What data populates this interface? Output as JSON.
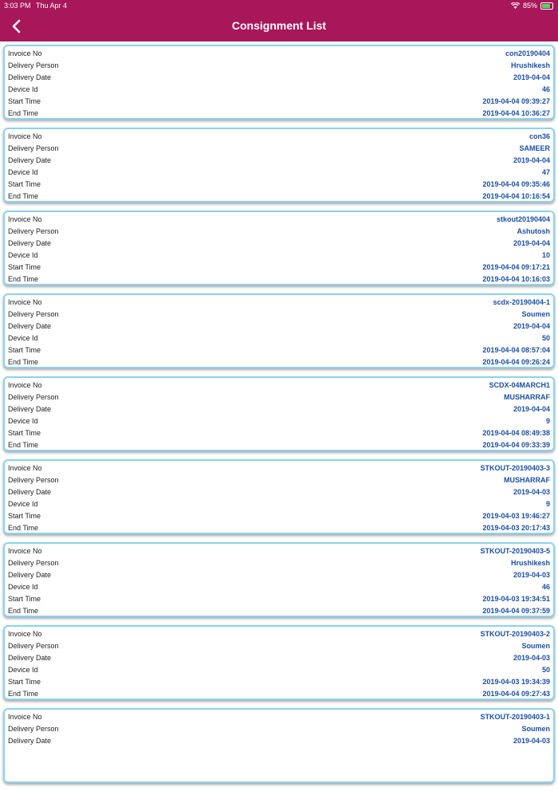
{
  "status_bar": {
    "time": "3:03 PM",
    "date": "Thu Apr 4",
    "battery": "85%"
  },
  "header": {
    "title": "Consignment List",
    "back_icon": "chevron-left-icon"
  },
  "labels": {
    "invoice": "Invoice No",
    "person": "Delivery Person",
    "date": "Delivery Date",
    "device": "Device Id",
    "start": "Start Time",
    "end": "End Time"
  },
  "consignments": [
    {
      "invoice": "con20190404",
      "person": "Hrushikesh",
      "date": "2019-04-04",
      "device": "46",
      "start": "2019-04-04 09:39:27",
      "end": "2019-04-04 10:36:27"
    },
    {
      "invoice": "con36",
      "person": "SAMEER",
      "date": "2019-04-04",
      "device": "47",
      "start": "2019-04-04 09:35:46",
      "end": "2019-04-04 10:16:54"
    },
    {
      "invoice": "stkout20190404",
      "person": "Ashutosh",
      "date": "2019-04-04",
      "device": "10",
      "start": "2019-04-04 09:17:21",
      "end": "2019-04-04 10:16:03"
    },
    {
      "invoice": "scdx-20190404-1",
      "person": "Soumen",
      "date": "2019-04-04",
      "device": "50",
      "start": "2019-04-04 08:57:04",
      "end": "2019-04-04 09:26:24"
    },
    {
      "invoice": "SCDX-04MARCH1",
      "person": "MUSHARRAF",
      "date": "2019-04-04",
      "device": "9",
      "start": "2019-04-04 08:49:38",
      "end": "2019-04-04 09:33:39"
    },
    {
      "invoice": "STKOUT-20190403-3",
      "person": "MUSHARRAF",
      "date": "2019-04-03",
      "device": "9",
      "start": "2019-04-03 19:46:27",
      "end": "2019-04-03 20:17:43"
    },
    {
      "invoice": "STKOUT-20190403-5",
      "person": "Hrushikesh",
      "date": "2019-04-03",
      "device": "46",
      "start": "2019-04-03 19:34:51",
      "end": "2019-04-04 09:37:59"
    },
    {
      "invoice": "STKOUT-20190403-2",
      "person": "Soumen",
      "date": "2019-04-03",
      "device": "50",
      "start": "2019-04-03 19:34:39",
      "end": "2019-04-04 09:27:43"
    },
    {
      "invoice": "STKOUT-20190403-1",
      "person": "Soumen",
      "date": "2019-04-03"
    }
  ]
}
